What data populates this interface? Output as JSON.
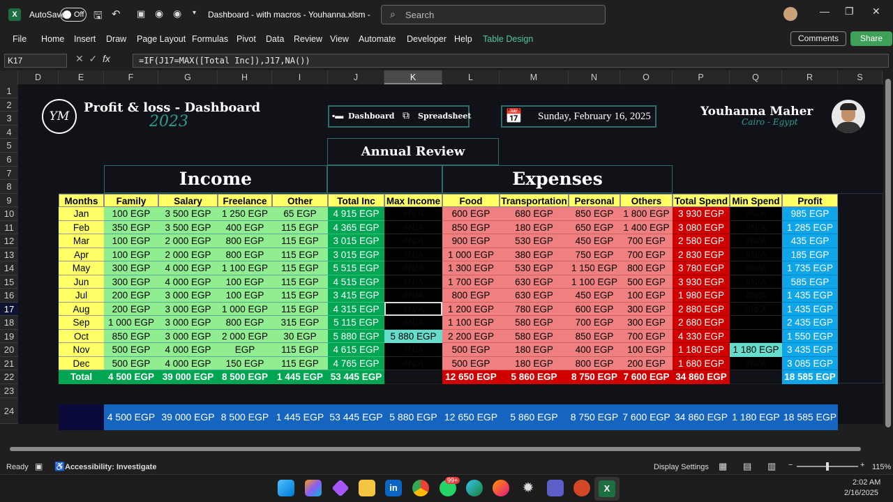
{
  "titlebar": {
    "autosave": "AutoSave",
    "toggle": "Off",
    "filename": "Dashboard - with macros - Youhanna.xlsm  -",
    "search_placeholder": "Search"
  },
  "ribbon": {
    "tabs": [
      "File",
      "Home",
      "Insert",
      "Draw",
      "Page Layout",
      "Formulas",
      "Pivot",
      "Data",
      "Review",
      "View",
      "Automate",
      "Developer",
      "Help",
      "Table Design"
    ],
    "comments": "Comments",
    "share": "Share"
  },
  "formula_bar": {
    "name_box": "K17",
    "formula": "=IF(J17=MAX([Total Inc]),J17,NA())"
  },
  "columns": [
    "D",
    "E",
    "F",
    "G",
    "H",
    "I",
    "J",
    "K",
    "L",
    "M",
    "N",
    "O",
    "P",
    "Q",
    "R",
    "S"
  ],
  "rows": [
    "1",
    "2",
    "3",
    "4",
    "5",
    "6",
    "7",
    "8",
    "9",
    "10",
    "11",
    "12",
    "13",
    "14",
    "15",
    "16",
    "17",
    "18",
    "19",
    "20",
    "21",
    "22",
    "23",
    "24"
  ],
  "dashboard": {
    "logo": "YM",
    "title": "Profit & loss - Dashboard",
    "year": "2023",
    "nav_dashboard": "Dashboard",
    "nav_spreadsheet": "Spreadsheet",
    "date": "Sunday, February 16, 2025",
    "author": "Youhanna Maher",
    "location": "Cairo - Egypt",
    "annual_review": "Annual Review",
    "income": "Income",
    "expenses": "Expenses"
  },
  "table": {
    "headers": [
      "Months",
      "Family",
      "Salary",
      "Freelance",
      "Other",
      "Total Inc",
      "Max Income",
      "Food",
      "Transportation",
      "Personal",
      "Others",
      "Total Spend",
      "Min Spend",
      "Profit"
    ],
    "rows": [
      [
        "Jan",
        "100 EGP",
        "3 500 EGP",
        "1 250 EGP",
        "65 EGP",
        "4 915 EGP",
        "#N/A",
        "600 EGP",
        "680 EGP",
        "850 EGP",
        "1 800 EGP",
        "3 930 EGP",
        "#N/A",
        "985 EGP"
      ],
      [
        "Feb",
        "350 EGP",
        "3 500 EGP",
        "400 EGP",
        "115 EGP",
        "4 365 EGP",
        "#N/A",
        "850 EGP",
        "180 EGP",
        "650 EGP",
        "1 400 EGP",
        "3 080 EGP",
        "#N/A",
        "1 285 EGP"
      ],
      [
        "Mar",
        "100 EGP",
        "2 000 EGP",
        "800 EGP",
        "115 EGP",
        "3 015 EGP",
        "#N/A",
        "900 EGP",
        "530 EGP",
        "450 EGP",
        "700 EGP",
        "2 580 EGP",
        "#N/A",
        "435 EGP"
      ],
      [
        "Apr",
        "100 EGP",
        "2 000 EGP",
        "800 EGP",
        "115 EGP",
        "3 015 EGP",
        "#N/A",
        "1 000 EGP",
        "380 EGP",
        "750 EGP",
        "700 EGP",
        "2 830 EGP",
        "#N/A",
        "185 EGP"
      ],
      [
        "May",
        "300 EGP",
        "4 000 EGP",
        "1 100 EGP",
        "115 EGP",
        "5 515 EGP",
        "#N/A",
        "1 300 EGP",
        "530 EGP",
        "1 150 EGP",
        "800 EGP",
        "3 780 EGP",
        "#N/A",
        "1 735 EGP"
      ],
      [
        "Jun",
        "300 EGP",
        "4 000 EGP",
        "100 EGP",
        "115 EGP",
        "4 515 EGP",
        "#N/A",
        "1 700 EGP",
        "630 EGP",
        "1 100 EGP",
        "500 EGP",
        "3 930 EGP",
        "#N/A",
        "585 EGP"
      ],
      [
        "Jul",
        "200 EGP",
        "3 000 EGP",
        "100 EGP",
        "115 EGP",
        "3 415 EGP",
        "#N/A",
        "800 EGP",
        "630 EGP",
        "450 EGP",
        "100 EGP",
        "1 980 EGP",
        "#N/A",
        "1 435 EGP"
      ],
      [
        "Aug",
        "200 EGP",
        "3 000 EGP",
        "1 000 EGP",
        "115 EGP",
        "4 315 EGP",
        "#N/A",
        "1 200 EGP",
        "780 EGP",
        "600 EGP",
        "300 EGP",
        "2 880 EGP",
        "#N/A",
        "1 435 EGP"
      ],
      [
        "Sep",
        "1 000 EGP",
        "3 000 EGP",
        "800 EGP",
        "315 EGP",
        "5 115 EGP",
        "#N/A",
        "1 100 EGP",
        "580 EGP",
        "700 EGP",
        "300 EGP",
        "2 680 EGP",
        "",
        "2 435 EGP"
      ],
      [
        "Oct",
        "850 EGP",
        "3 000 EGP",
        "2 000 EGP",
        "30 EGP",
        "5 880 EGP",
        "5 880 EGP",
        "2 200 EGP",
        "580 EGP",
        "850 EGP",
        "700 EGP",
        "4 330 EGP",
        "",
        "1 550 EGP"
      ],
      [
        "Nov",
        "500 EGP",
        "4 000 EGP",
        "EGP",
        "115 EGP",
        "4 615 EGP",
        "#N/A",
        "500 EGP",
        "180 EGP",
        "400 EGP",
        "100 EGP",
        "1 180 EGP",
        "1 180 EGP",
        "3 435 EGP"
      ],
      [
        "Dec",
        "500 EGP",
        "4 000 EGP",
        "150 EGP",
        "115 EGP",
        "4 765 EGP",
        "#N/A",
        "500 EGP",
        "180 EGP",
        "800 EGP",
        "200 EGP",
        "1 680 EGP",
        "#N/A",
        "3 085 EGP"
      ]
    ],
    "totals": [
      "Total",
      "4 500 EGP",
      "39 000 EGP",
      "8 500 EGP",
      "1 445 EGP",
      "53 445 EGP",
      "",
      "12 650 EGP",
      "5 860 EGP",
      "8 750 EGP",
      "7 600 EGP",
      "34 860 EGP",
      "",
      "18 585 EGP"
    ],
    "summary": [
      "",
      "4 500 EGP",
      "39 000 EGP",
      "8 500 EGP",
      "1 445 EGP",
      "53 445 EGP",
      "5 880 EGP",
      "12 650 EGP",
      "5 860 EGP",
      "8 750 EGP",
      "7 600 EGP",
      "34 860 EGP",
      "1 180 EGP",
      "18 585 EGP"
    ]
  },
  "statusbar": {
    "ready": "Ready",
    "accessibility": "Accessibility: Investigate",
    "display_settings": "Display Settings",
    "zoom": "115%"
  },
  "taskbar": {
    "time": "2:02 AM",
    "date": "2/16/2025",
    "badge": "99+"
  },
  "colors": {
    "income_green": "#90ee90",
    "total_inc": "#00a651",
    "expense_red": "#f08080",
    "total_spend": "#d10000",
    "profit_blue": "#0ea5e9",
    "months_yellow": "#ffff66",
    "highlight": "#66ddcc"
  }
}
